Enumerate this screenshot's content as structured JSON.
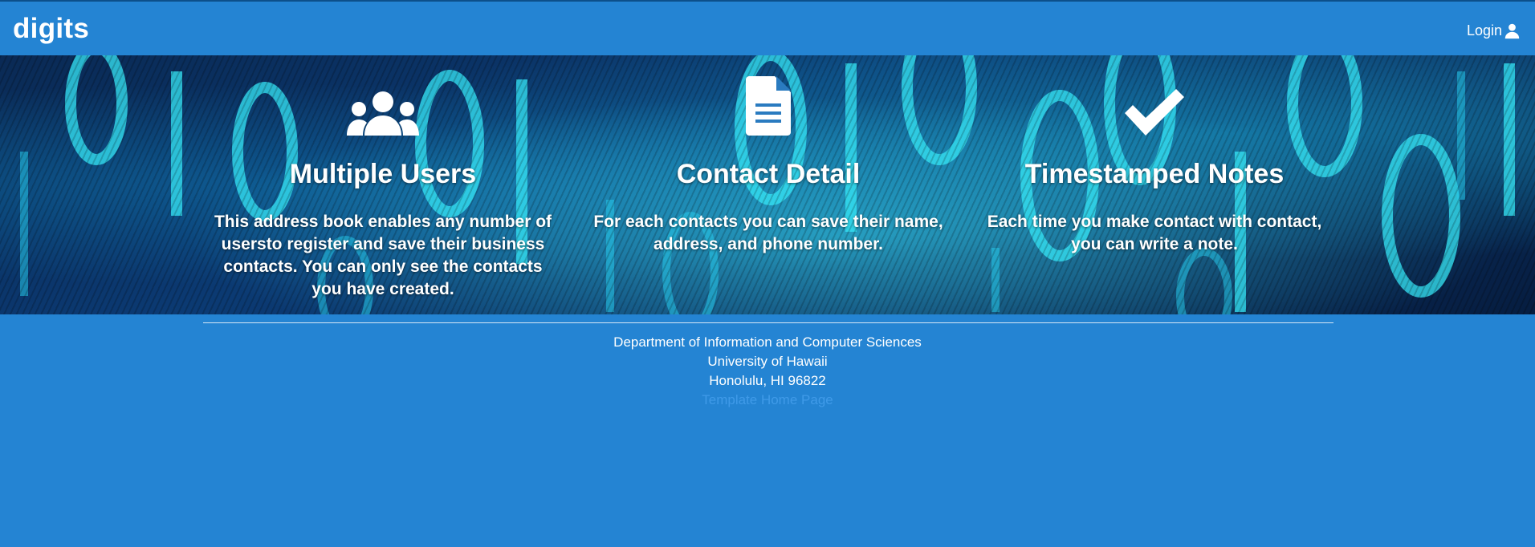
{
  "navbar": {
    "brand": "digits",
    "login_label": "Login",
    "login_icon": "user-icon"
  },
  "features": [
    {
      "icon": "users-icon",
      "title": "Multiple Users",
      "description": "This address book enables any number of usersto register and save their business contacts. You can only see the contacts you have created."
    },
    {
      "icon": "file-text-icon",
      "title": "Contact Detail",
      "description": "For each contacts you can save their name, address, and phone number."
    },
    {
      "icon": "checkmark-icon",
      "title": "Timestamped Notes",
      "description": "Each time you make contact with contact, you can write a note."
    }
  ],
  "footer": {
    "line1": "Department of Information and Computer Sciences",
    "line2": "University of Hawaii",
    "line3": "Honolulu, HI 96822",
    "link": "Template Home Page"
  },
  "colors": {
    "primary": "#2484d3",
    "text": "#ffffff",
    "footer_link": "#3f9ae8"
  }
}
